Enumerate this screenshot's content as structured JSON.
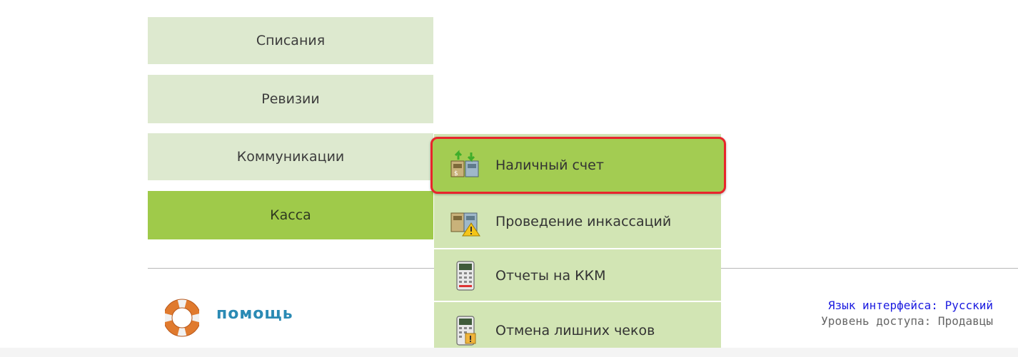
{
  "menu": {
    "items": [
      {
        "label": "Списания",
        "active": false
      },
      {
        "label": "Ревизии",
        "active": false
      },
      {
        "label": "Коммуникации",
        "active": false
      },
      {
        "label": "Касса",
        "active": true
      }
    ]
  },
  "submenu": {
    "items": [
      {
        "label": "Наличный счет",
        "icon": "cash-account-icon",
        "active": true
      },
      {
        "label": "Проведение инкассаций",
        "icon": "encashment-warning-icon",
        "active": false
      },
      {
        "label": "Отчеты на ККМ",
        "icon": "cash-register-report-icon",
        "active": false
      },
      {
        "label": "Отмена лишних чеков",
        "icon": "cancel-receipts-icon",
        "active": false
      }
    ]
  },
  "footer": {
    "help_label": "помощь",
    "language_link": "Язык интерфейса: Русский",
    "access_level": "Уровень доступа: Продавцы"
  },
  "colors": {
    "menu_inactive": "#dde9cf",
    "menu_active": "#9fca4a",
    "submenu_bg": "#d2e5b4",
    "highlight_border": "#e8252b",
    "help_link": "#2a8ab4",
    "language_link": "#1c1ce0"
  }
}
